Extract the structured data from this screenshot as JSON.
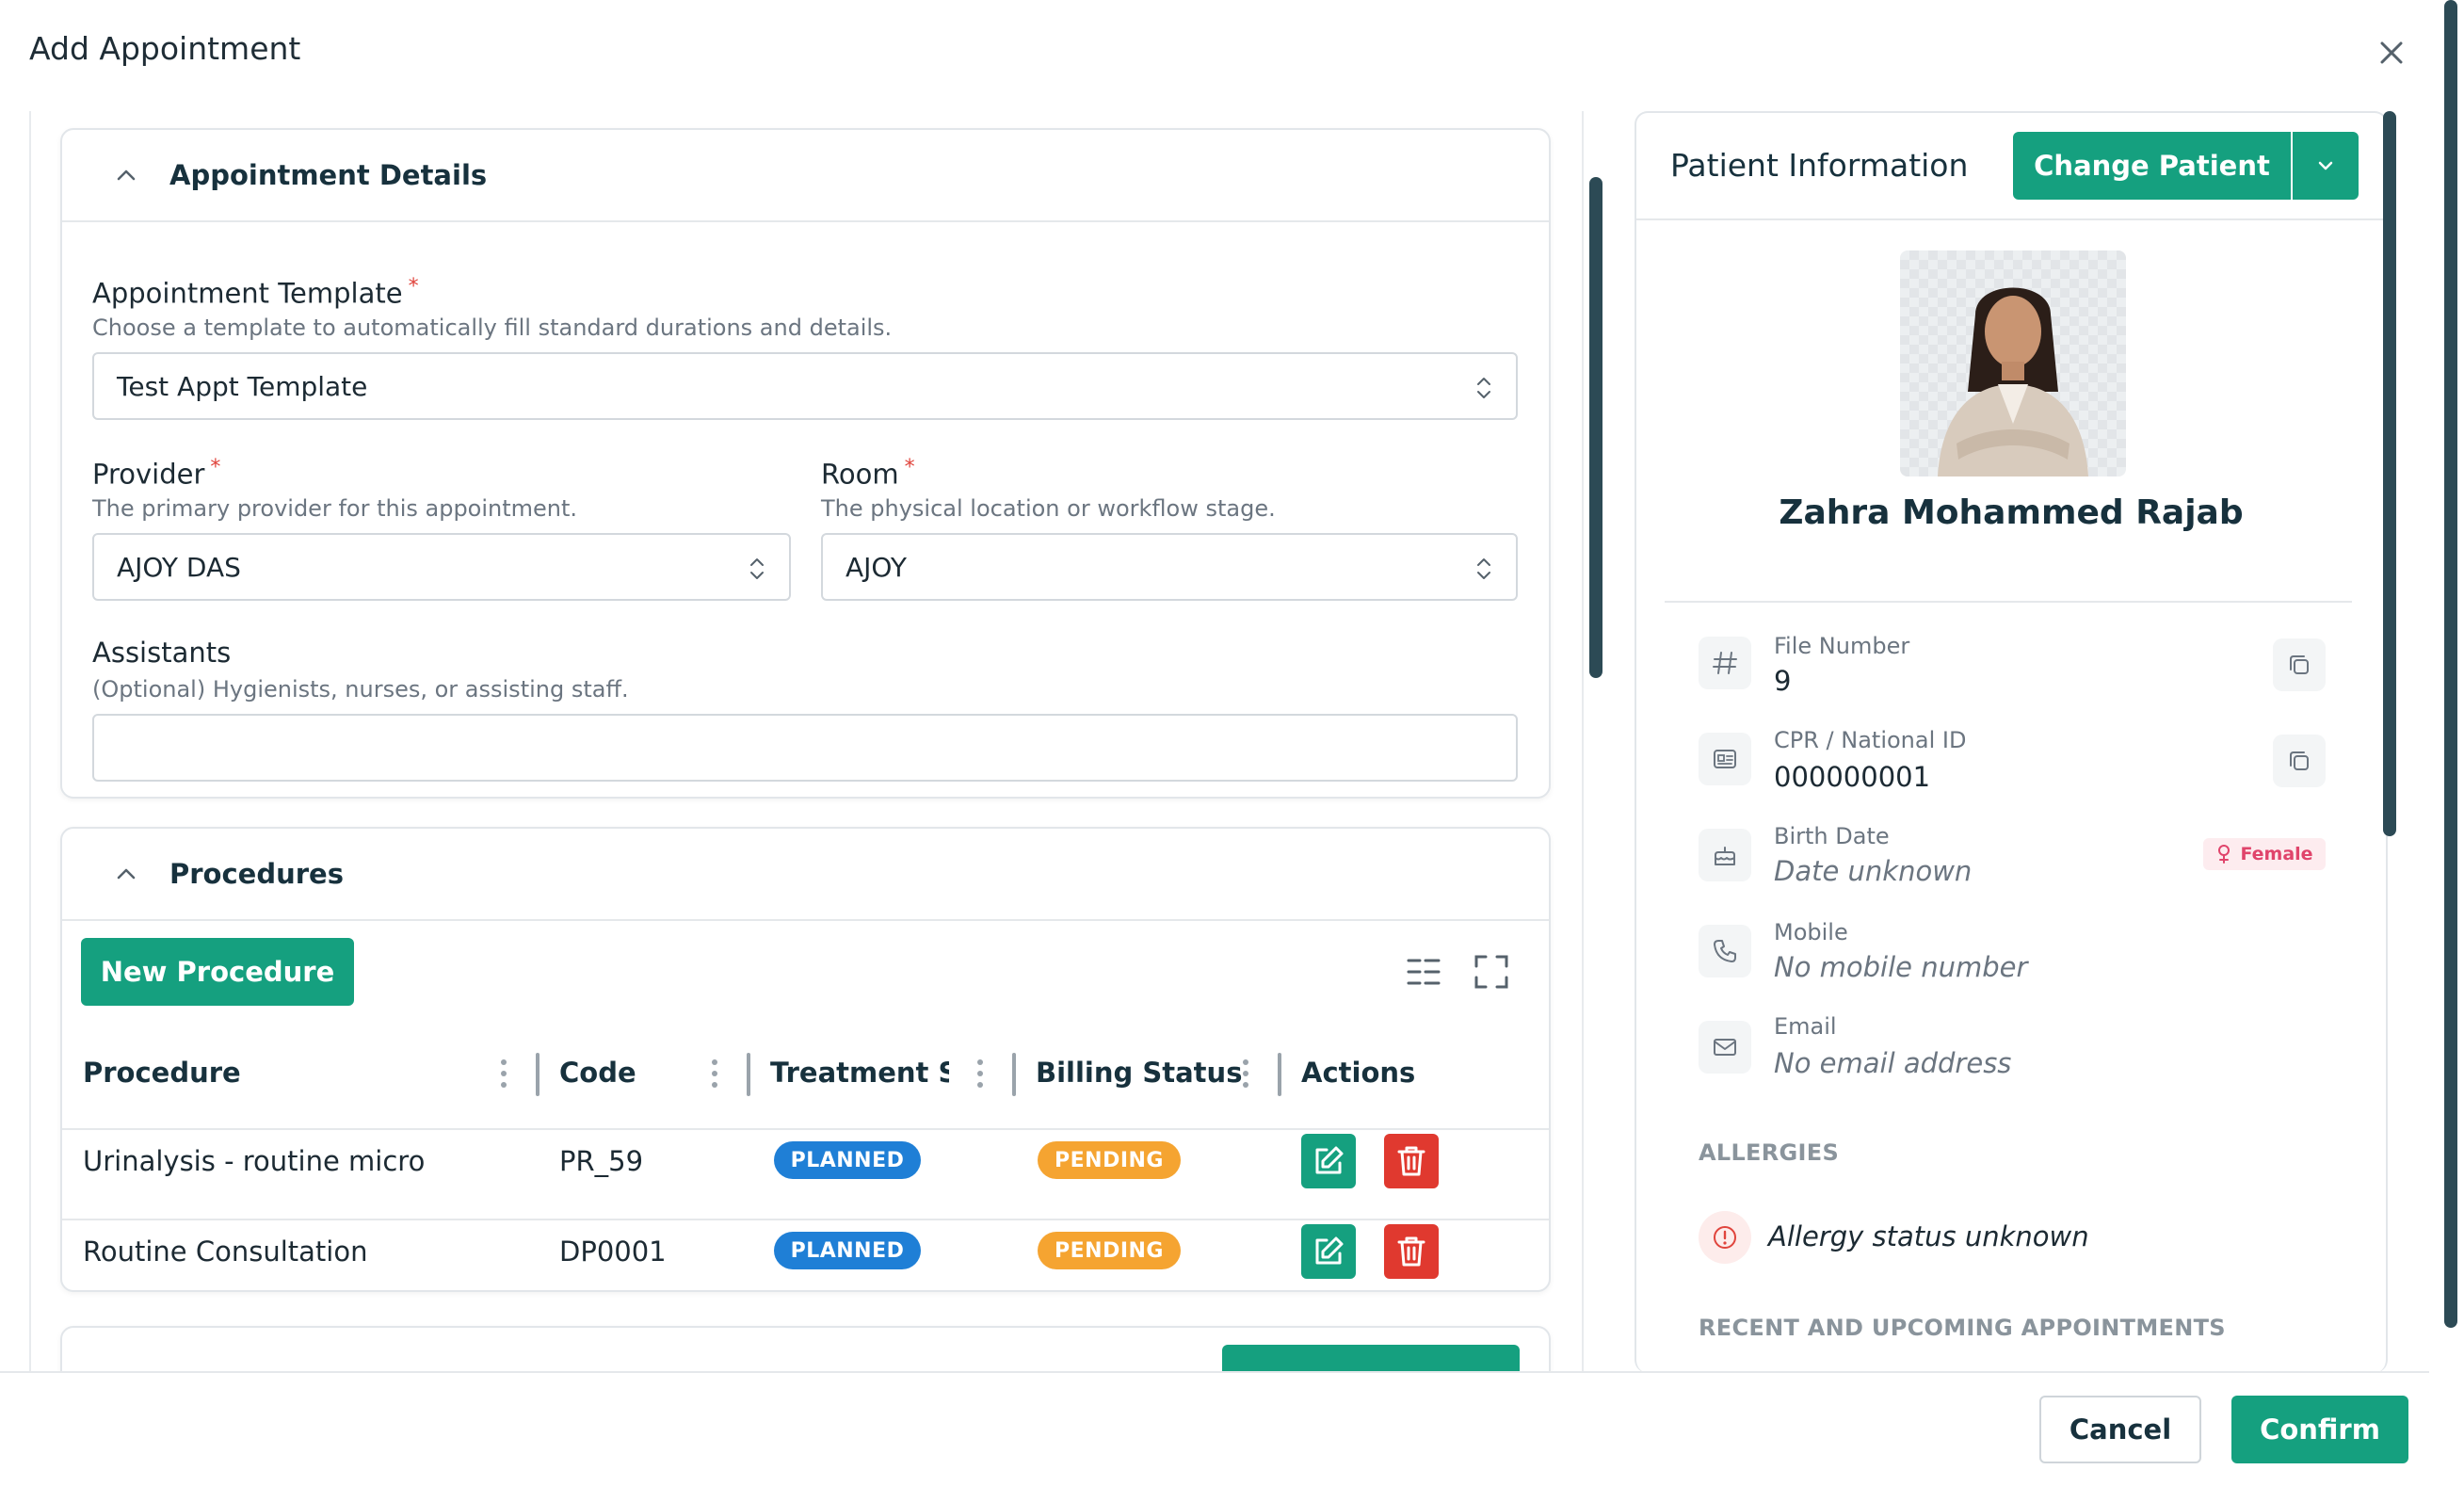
{
  "modal": {
    "title": "Add Appointment"
  },
  "appointment_details": {
    "title": "Appointment Details",
    "template": {
      "label": "Appointment Template",
      "required_mark": "*",
      "hint": "Choose a template to automatically fill standard durations and details.",
      "value": "Test Appt Template"
    },
    "provider": {
      "label": "Provider",
      "required_mark": "*",
      "hint": "The primary provider for this appointment.",
      "value": "AJOY DAS"
    },
    "room": {
      "label": "Room",
      "required_mark": "*",
      "hint": "The physical location or workflow stage.",
      "value": "AJOY"
    },
    "assistants": {
      "label": "Assistants",
      "hint": "(Optional) Hygienists, nurses, or assisting staff.",
      "value": ""
    }
  },
  "procedures": {
    "title": "Procedures",
    "new_button": "New Procedure",
    "columns": [
      "Procedure",
      "Code",
      "Treatment Sta",
      "Billing Status",
      "Actions"
    ],
    "rows": [
      {
        "procedure": "Urinalysis - routine micro",
        "code": "PR_59",
        "treatment_status": "PLANNED",
        "billing_status": "PENDING"
      },
      {
        "procedure": "Routine Consultation",
        "code": "DP0001",
        "treatment_status": "PLANNED",
        "billing_status": "PENDING"
      }
    ]
  },
  "patient": {
    "section_title": "Patient Information",
    "change_button": "Change Patient",
    "name": "Zahra Mohammed Rajab",
    "file_number": {
      "label": "File Number",
      "value": "9"
    },
    "national_id": {
      "label": "CPR / National ID",
      "value": "000000001"
    },
    "birth_date": {
      "label": "Birth Date",
      "value": "Date unknown"
    },
    "gender": "Female",
    "mobile": {
      "label": "Mobile",
      "value": "No mobile number"
    },
    "email": {
      "label": "Email",
      "value": "No email address"
    },
    "allergies": {
      "caption": "ALLERGIES",
      "value": "Allergy status unknown"
    },
    "appointments_caption": "RECENT AND UPCOMING APPOINTMENTS"
  },
  "footer": {
    "cancel": "Cancel",
    "confirm": "Confirm"
  },
  "colors": {
    "primary": "#15a07f",
    "danger": "#e0392f",
    "planned": "#1f7fd6",
    "pending": "#f5a431",
    "heading": "#17313d"
  }
}
